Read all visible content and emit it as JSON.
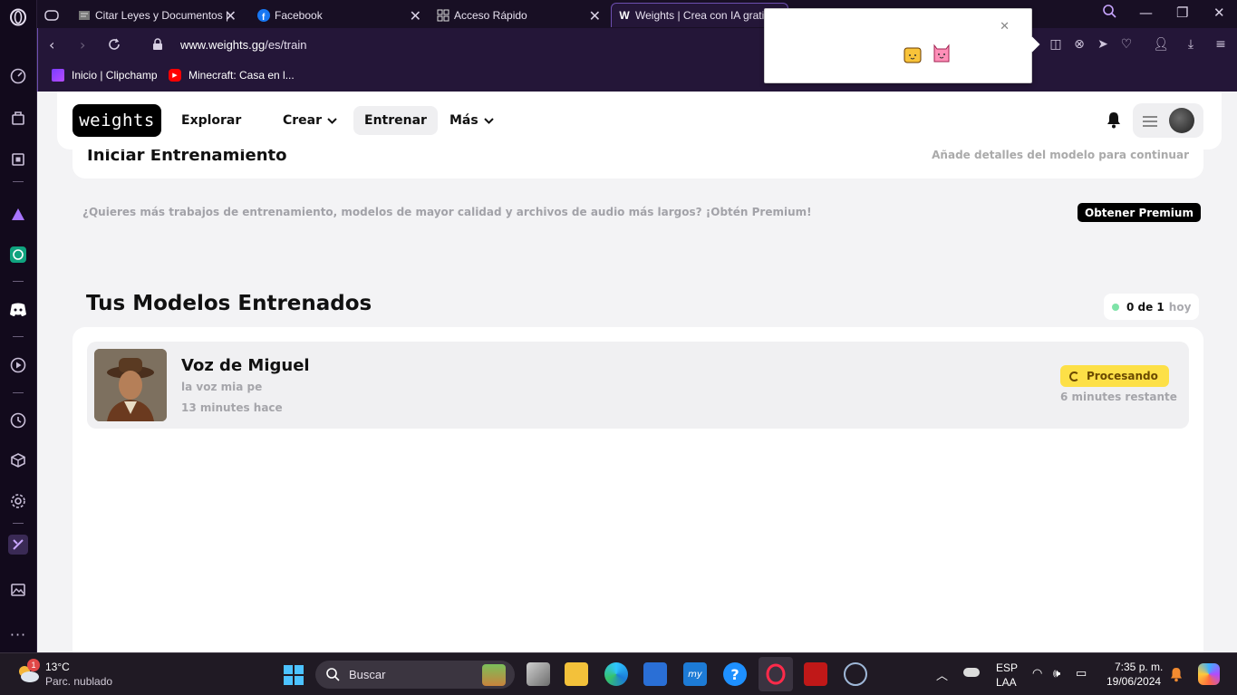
{
  "browser": {
    "tabs": [
      {
        "label": "Citar Leyes y Documentos |",
        "icon": "document-icon"
      },
      {
        "label": "Facebook",
        "icon": "facebook-icon"
      },
      {
        "label": "Acceso Rápido",
        "icon": "grid-icon"
      },
      {
        "label": "Weights | Crea con IA grati",
        "icon": "weights-icon",
        "active": true
      }
    ],
    "url_host": "www.weights.gg",
    "url_path": "/es/train",
    "bookmarks": [
      {
        "label": "Inicio | Clipchamp",
        "icon": "clipchamp-icon"
      },
      {
        "label": "Minecraft: Casa en l...",
        "icon": "youtube-icon"
      }
    ]
  },
  "site": {
    "logo": "weights",
    "nav": [
      {
        "label": "Explorar"
      },
      {
        "label": "Crear",
        "dropdown": true
      },
      {
        "label": "Entrenar",
        "active": true
      },
      {
        "label": "Más",
        "dropdown": true
      }
    ]
  },
  "train_card": {
    "title": "Iniciar Entrenamiento",
    "hint": "Añade detalles del modelo para continuar"
  },
  "promo": {
    "text": "¿Quieres más trabajos de entrenamiento, modelos de mayor calidad y archivos de audio más largos? ¡Obtén Premium!",
    "button": "Obtener Premium"
  },
  "models": {
    "title": "Tus Modelos Entrenados",
    "quota_count": "0 de 1",
    "quota_suffix": "hoy",
    "items": [
      {
        "name": "Voz de Miguel",
        "description": "la voz mia pe",
        "time": "13 minutes hace",
        "status": "Procesando",
        "remaining": "6 minutes restante"
      }
    ]
  },
  "taskbar": {
    "weather_temp": "13°C",
    "weather_desc": "Parc. nublado",
    "weather_badge": "1",
    "search_placeholder": "Buscar",
    "lang_top": "ESP",
    "lang_bottom": "LAA",
    "time": "7:35 p. m.",
    "date": "19/06/2024"
  },
  "colors": {
    "accent": "#6d4fb0",
    "status_yellow": "#fde047",
    "quota_dot": "#7ee3a8"
  }
}
